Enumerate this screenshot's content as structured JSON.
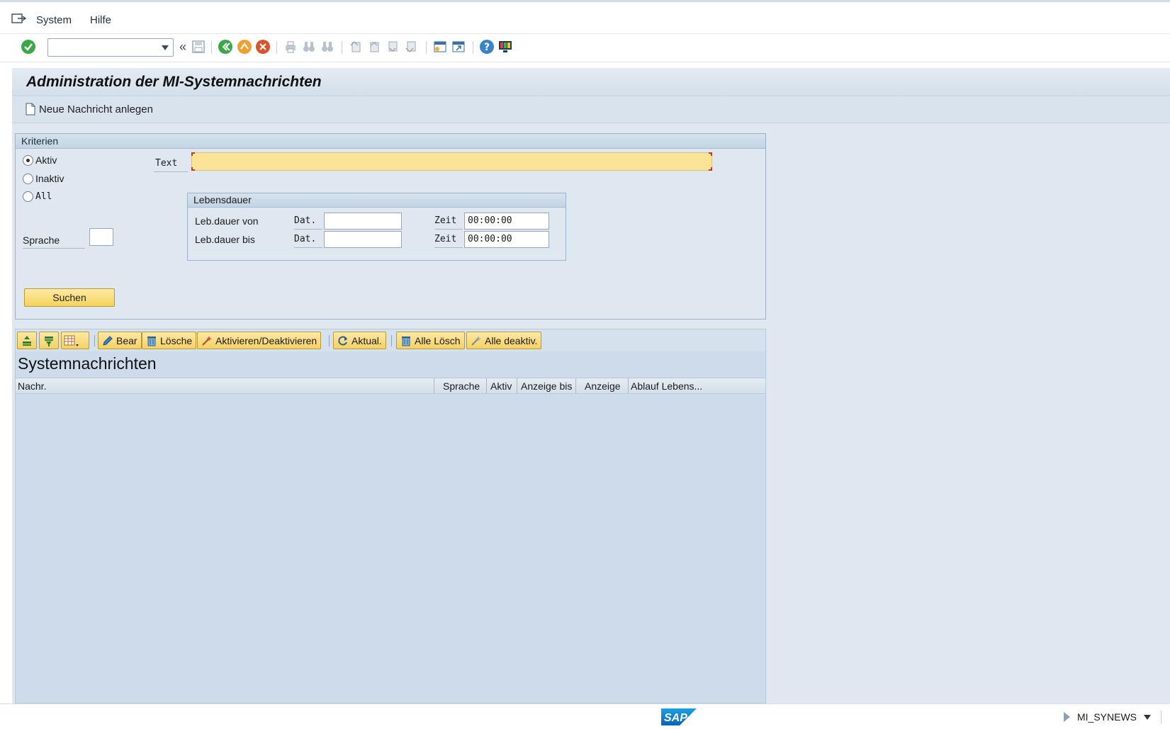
{
  "menu": {
    "system": "System",
    "hilfe": "Hilfe"
  },
  "toolbar": {
    "command_field": ""
  },
  "page": {
    "title": "Administration der MI-Systemnachrichten",
    "new_message_label": "Neue Nachricht anlegen"
  },
  "criteria": {
    "group_title": "Kriterien",
    "radios": [
      {
        "label": "Aktiv",
        "checked": true
      },
      {
        "label": "Inaktiv",
        "checked": false
      },
      {
        "label": "All",
        "checked": false
      }
    ],
    "text_label": "Text",
    "text_value": "",
    "sprache_label": "Sprache",
    "sprache_value": "",
    "lifetime": {
      "title": "Lebensdauer",
      "rows": [
        {
          "label": "Leb.dauer von",
          "date_label": "Dat.",
          "date_value": "",
          "time_label": "Zeit",
          "time_value": "00:00:00"
        },
        {
          "label": "Leb.dauer bis",
          "date_label": "Dat.",
          "date_value": "",
          "time_label": "Zeit",
          "time_value": "00:00:00"
        }
      ]
    },
    "search_button": "Suchen"
  },
  "alv": {
    "buttons": {
      "edit": "Bear",
      "delete": "Lösche",
      "toggle": "Aktivieren/Deaktivieren",
      "refresh": "Aktual.",
      "delete_all": "Alle Lösch",
      "deactivate_all": "Alle deaktiv."
    },
    "title": "Systemnachrichten",
    "columns": [
      "Nachr.",
      "Sprache",
      "Aktiv",
      "Anzeige bis",
      "Anzeige",
      "Ablauf Lebens..."
    ],
    "rows": []
  },
  "status": {
    "logo": "SAP",
    "transaction": "MI_SYNEWS"
  },
  "colors": {
    "accent_yellow": "#f6d35b",
    "input_highlight": "#fbe497",
    "panel_blue": "#dfe8f1"
  }
}
